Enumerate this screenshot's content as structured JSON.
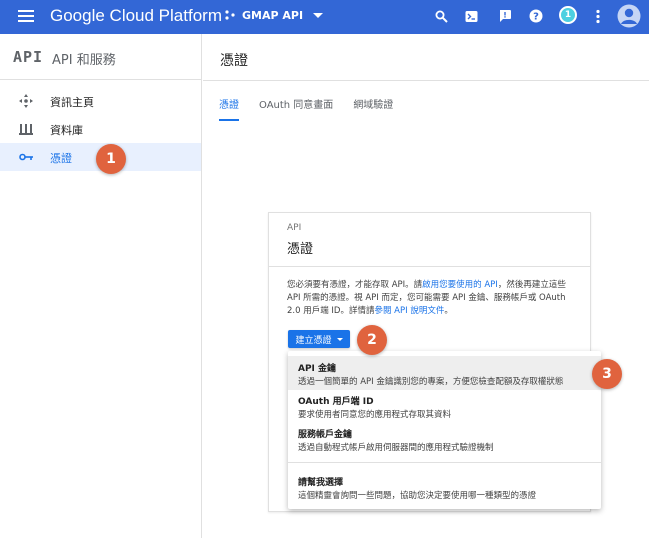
{
  "topbar": {
    "brand": "Google Cloud Platform",
    "project": "GMAP API",
    "notification_count": "1",
    "icons": [
      "menu-icon",
      "search-icon",
      "cloud-shell-icon",
      "feedback-icon",
      "help-icon",
      "more-vert-icon",
      "account-icon"
    ]
  },
  "sidebar": {
    "logo": "API",
    "title": "API 和服務",
    "items": [
      {
        "label": "資訊主頁",
        "icon": "dashboard-icon"
      },
      {
        "label": "資料庫",
        "icon": "library-icon"
      },
      {
        "label": "憑證",
        "icon": "key-icon"
      }
    ]
  },
  "main": {
    "title": "憑證",
    "tabs": [
      {
        "label": "憑證"
      },
      {
        "label": "OAuth 同意畫面"
      },
      {
        "label": "網域驗證"
      }
    ]
  },
  "card": {
    "small_label": "API",
    "title": "憑證",
    "desc_part1": "您必須要有憑證，才能存取 API。請",
    "desc_link1": "啟用您要使用的 API",
    "desc_part2": "，然後再建立這些 API 所需的憑證。視 API 而定，您可能需要 API 金鑰、服務帳戶或 OAuth 2.0 用戶端 ID。詳情請",
    "desc_link2": "參閱 API 說明文件",
    "desc_part3": "。"
  },
  "create_button": {
    "label": "建立憑證"
  },
  "menu": {
    "items": [
      {
        "title": "API 金鑰",
        "desc": "透過一個簡單的 API 金鑰識別您的專案，方便您檢查配額及存取權狀態"
      },
      {
        "title": "OAuth 用戶端 ID",
        "desc": "要求使用者同意您的應用程式存取其資料"
      },
      {
        "title": "服務帳戶金鑰",
        "desc": "透過自動程式帳戶啟用伺服器間的應用程式驗證機制"
      },
      {
        "title": "請幫我選擇",
        "desc": "這個精靈會詢問一些問題，協助您決定要使用哪一種類型的憑證"
      }
    ]
  },
  "callouts": [
    "1",
    "2",
    "3"
  ],
  "colors": {
    "topbar": "#3367d6",
    "accent": "#1a73e8",
    "callout": "#e0633e"
  }
}
